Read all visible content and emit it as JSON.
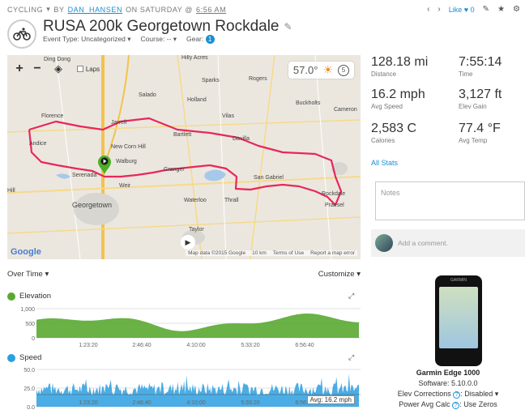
{
  "header": {
    "activity_type": "CYCLING",
    "by": "BY",
    "user": "DAN_HANSEN",
    "on": "ON SATURDAY @",
    "time": "6:56 AM",
    "title": "RUSA 200k Georgetown Rockdale",
    "event_type": "Event Type: Uncategorized",
    "course": "Course: --",
    "gear": "Gear:",
    "gear_count": "1"
  },
  "toolbar": {
    "like_label": "Like",
    "like_count": "0"
  },
  "map": {
    "temperature": "57.0°",
    "wind": "5",
    "laps_label": "Laps",
    "zoom_in": "+",
    "zoom_out": "−",
    "footer": [
      "Map data ©2015 Google",
      "10 km",
      "Terms of Use",
      "Report a map error"
    ],
    "google_label": "Google",
    "places": [
      {
        "name": "Ding Dong"
      },
      {
        "name": "Hilly Acres"
      },
      {
        "name": "Holland"
      },
      {
        "name": "Salado"
      },
      {
        "name": "Sparks"
      },
      {
        "name": "Rogers"
      },
      {
        "name": "Buckholts"
      },
      {
        "name": "Cameron"
      },
      {
        "name": "Florence"
      },
      {
        "name": "Jarrell"
      },
      {
        "name": "Bartlett"
      },
      {
        "name": "Vilas"
      },
      {
        "name": "Andice"
      },
      {
        "name": "New Corn Hill"
      },
      {
        "name": "Walburg"
      },
      {
        "name": "Davilla"
      },
      {
        "name": "Granger"
      },
      {
        "name": "San Gabriel"
      },
      {
        "name": "Rockdale"
      },
      {
        "name": "Georgetown"
      },
      {
        "name": "Weir"
      },
      {
        "name": "Waterloo"
      },
      {
        "name": "Thrall"
      },
      {
        "name": "Praesel"
      },
      {
        "name": "Taylor"
      },
      {
        "name": "Hill"
      },
      {
        "name": "Serenada"
      }
    ]
  },
  "stats": [
    {
      "value": "128.18 mi",
      "label": "Distance"
    },
    {
      "value": "7:55:14",
      "label": "Time"
    },
    {
      "value": "16.2 mph",
      "label": "Avg Speed"
    },
    {
      "value": "3,127 ft",
      "label": "Elev Gain"
    },
    {
      "value": "2,583 C",
      "label": "Calories"
    },
    {
      "value": "77.4 °F",
      "label": "Avg Temp"
    }
  ],
  "all_stats_label": "All Stats",
  "notes_placeholder": "Notes",
  "comment_placeholder": "Add a comment.",
  "timeline": {
    "mode": "Over Time",
    "customize": "Customize"
  },
  "elevation": {
    "title": "Elevation",
    "color": "#5aa832",
    "yticks": [
      "1,000",
      "500",
      "0"
    ],
    "xticks": [
      "1:23:20",
      "2:46:40",
      "4:10:00",
      "5:33:20",
      "6:56:40"
    ]
  },
  "speed": {
    "title": "Speed",
    "color": "#2b9fe0",
    "yticks": [
      "50.0",
      "25.0",
      "0.0"
    ],
    "xticks": [
      "1:23:20",
      "2:46:40",
      "4:10:00",
      "5:33:20",
      "6:56:40"
    ],
    "avg_label": "Avg: 16.2 mph"
  },
  "device": {
    "name": "Garmin Edge 1000",
    "software": "Software: 5.10.0.0",
    "elev_corrections_label": "Elev Corrections",
    "elev_corrections_value": "Disabled",
    "power_label": "Power Avg Calc",
    "power_value": "Use Zeros"
  }
}
